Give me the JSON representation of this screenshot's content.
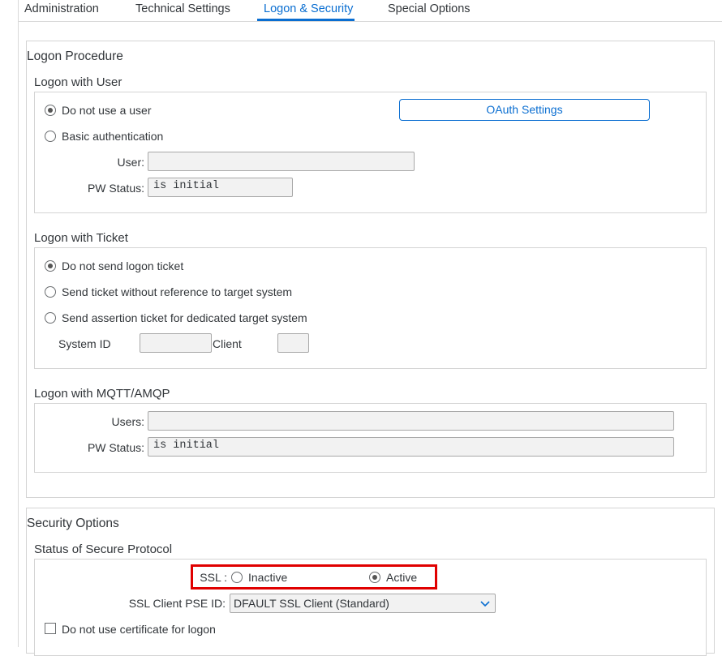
{
  "tabs": [
    {
      "label": "Administration"
    },
    {
      "label": "Technical Settings"
    },
    {
      "label": "Logon & Security"
    },
    {
      "label": "Special Options"
    }
  ],
  "logon_procedure": {
    "title": "Logon Procedure",
    "user_section": {
      "title": "Logon with User",
      "radio_no_user": "Do not use a user",
      "radio_basic": "Basic authentication",
      "user_label": "User:",
      "user_value": "",
      "pw_status_label": "PW Status:",
      "pw_status_value": "is initial",
      "oauth_button": "OAuth Settings"
    },
    "ticket_section": {
      "title": "Logon with Ticket",
      "radio_no_ticket": "Do not send logon ticket",
      "radio_send_ticket": "Send ticket without reference to target system",
      "radio_assertion": "Send assertion ticket for dedicated target system",
      "system_id_label": "System ID",
      "system_id_value": "",
      "client_label": "Client",
      "client_value": ""
    },
    "mqtt_section": {
      "title": "Logon with MQTT/AMQP",
      "users_label": "Users:",
      "users_value": "",
      "pw_status_label": "PW Status:",
      "pw_status_value": "is initial"
    }
  },
  "security_options": {
    "title": "Security Options",
    "secure_protocol": {
      "title": "Status of Secure Protocol",
      "ssl_label": "SSL :",
      "ssl_inactive": "Inactive",
      "ssl_active": "Active",
      "ssl_selected": "Active",
      "pse_label": "SSL Client PSE ID:",
      "pse_value": "DFAULT SSL Client (Standard)",
      "no_cert_label": "Do not use certificate for logon"
    }
  },
  "colors": {
    "accent": "#0a6ed1",
    "highlight": "#e00000"
  }
}
